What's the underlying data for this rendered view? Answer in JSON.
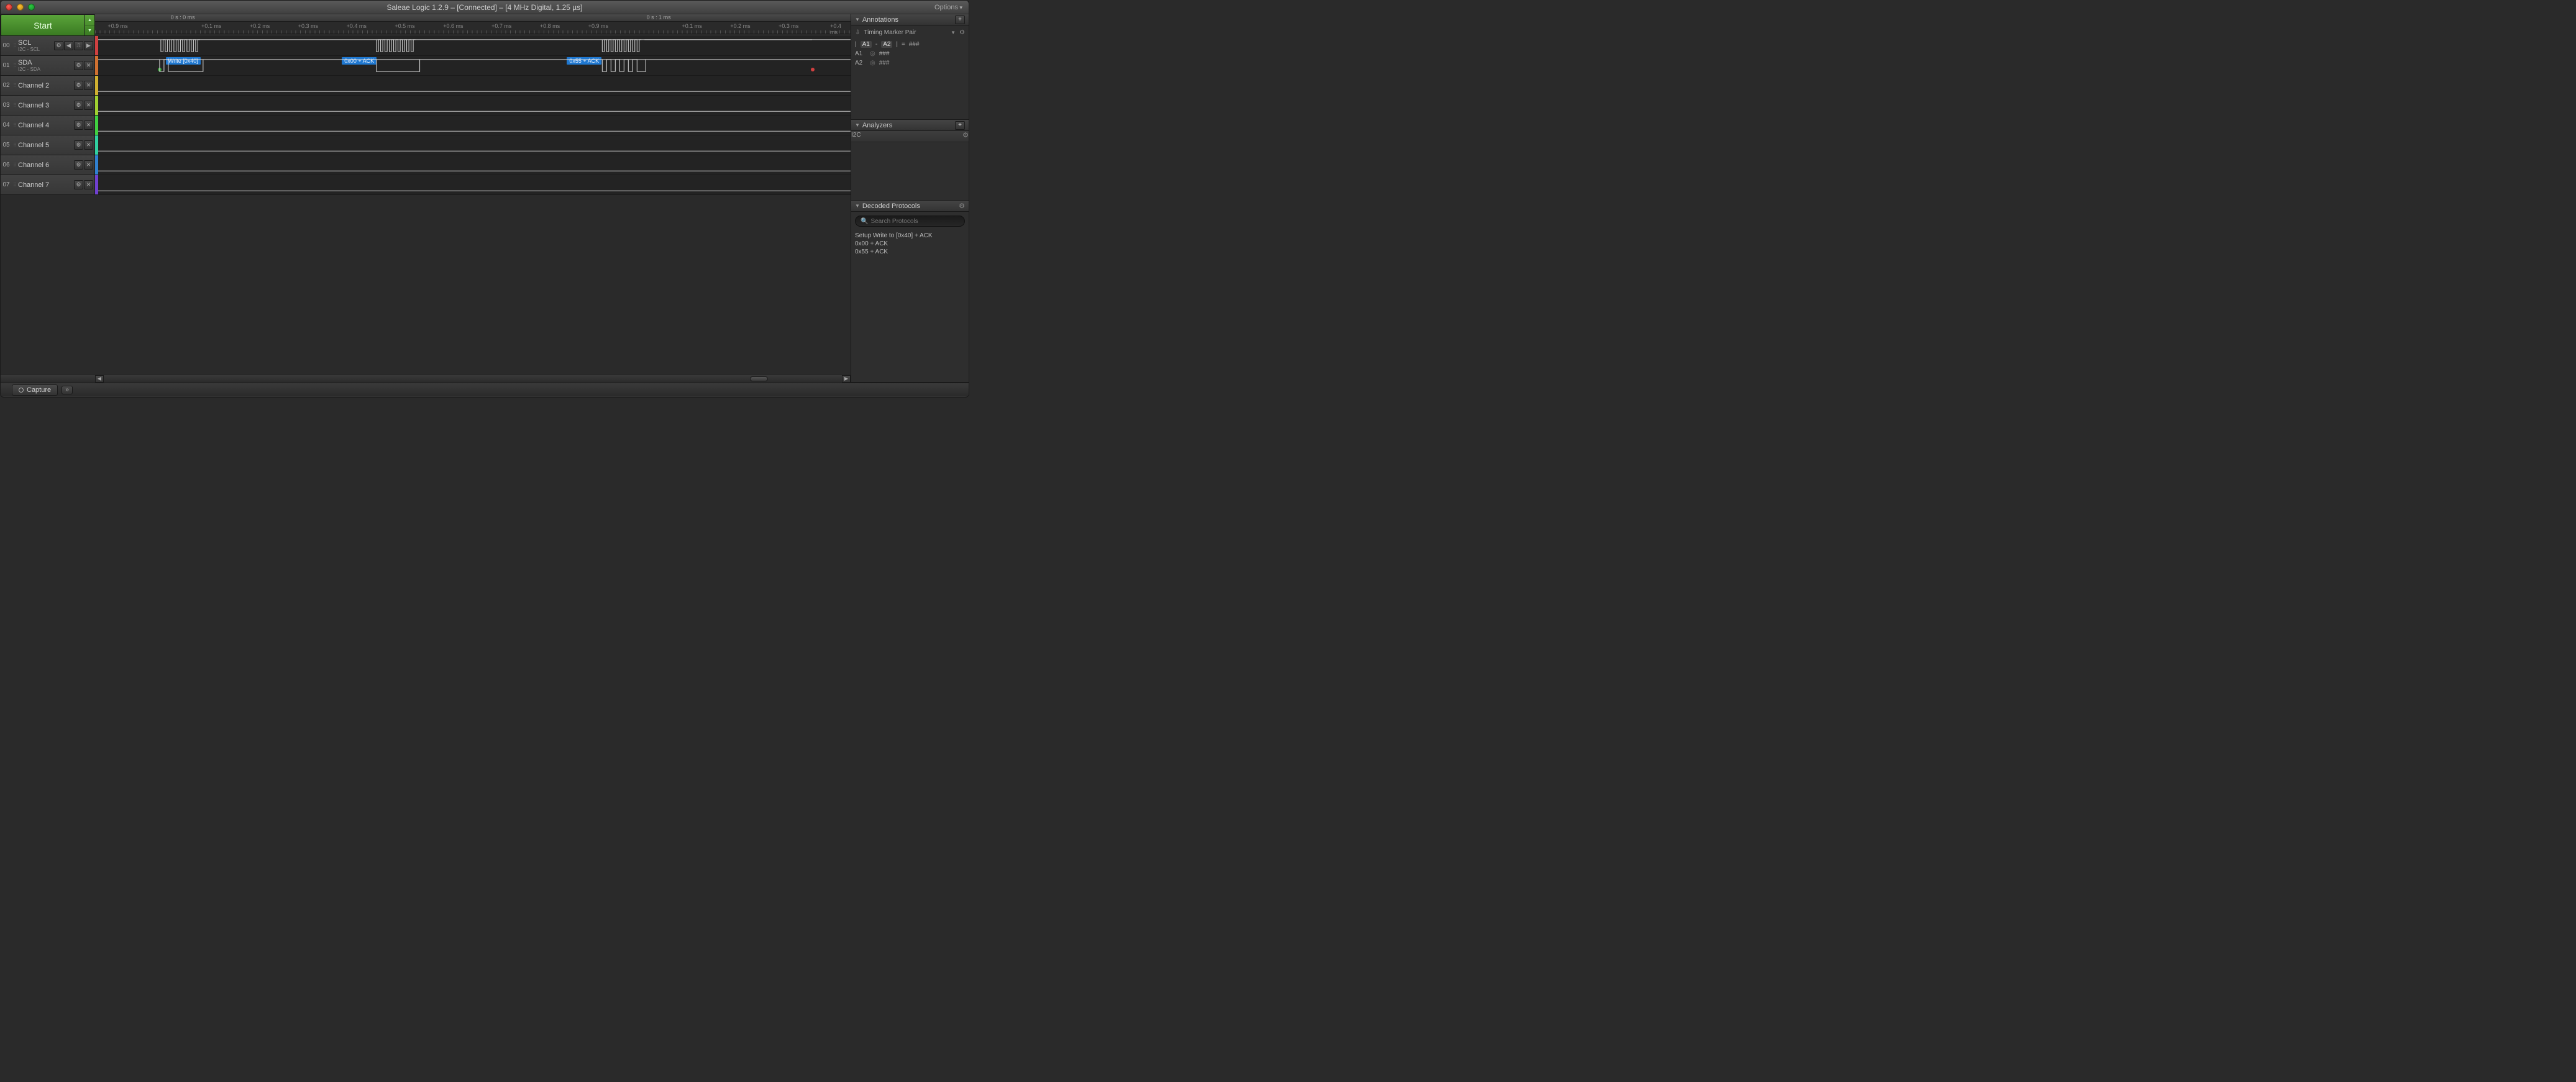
{
  "window": {
    "title": "Saleae Logic 1.2.9 – [Connected] – [4 MHz Digital, 1.25 µs]",
    "options_label": "Options"
  },
  "controls": {
    "start_label": "Start"
  },
  "timeline": {
    "anchors": [
      {
        "label": "0 s : 0 ms",
        "left_pct": 10
      },
      {
        "label": "0 s : 1 ms",
        "left_pct": 73
      }
    ],
    "minor_ticks": [
      {
        "label": "+0.9 ms",
        "left_pct": 3.0
      },
      {
        "label": "+0.1 ms",
        "left_pct": 15.4
      },
      {
        "label": "+0.2 ms",
        "left_pct": 21.8
      },
      {
        "label": "+0.3 ms",
        "left_pct": 28.2
      },
      {
        "label": "+0.4 ms",
        "left_pct": 34.6
      },
      {
        "label": "+0.5 ms",
        "left_pct": 41.0
      },
      {
        "label": "+0.6 ms",
        "left_pct": 47.4
      },
      {
        "label": "+0.7 ms",
        "left_pct": 53.8
      },
      {
        "label": "+0.8 ms",
        "left_pct": 60.2
      },
      {
        "label": "+0.9 ms",
        "left_pct": 66.6
      },
      {
        "label": "+0.1 ms",
        "left_pct": 79.0
      },
      {
        "label": "+0.2 ms",
        "left_pct": 85.4
      },
      {
        "label": "+0.3 ms",
        "left_pct": 91.8
      },
      {
        "label": "+0.4 ms",
        "left_pct": 98.2
      }
    ]
  },
  "channels": [
    {
      "idx": "00",
      "name": "SCL",
      "sub": "I2C - SCL",
      "color": "#d04040",
      "extra_buttons": true
    },
    {
      "idx": "01",
      "name": "SDA",
      "sub": "I2C - SDA",
      "color": "#d07030",
      "extra_buttons": false
    },
    {
      "idx": "02",
      "name": "Channel 2",
      "sub": "",
      "color": "#d0b030",
      "extra_buttons": false
    },
    {
      "idx": "03",
      "name": "Channel 3",
      "sub": "",
      "color": "#a0d030",
      "extra_buttons": false
    },
    {
      "idx": "04",
      "name": "Channel 4",
      "sub": "",
      "color": "#40d040",
      "extra_buttons": false
    },
    {
      "idx": "05",
      "name": "Channel 5",
      "sub": "",
      "color": "#30d0a0",
      "extra_buttons": false
    },
    {
      "idx": "06",
      "name": "Channel 6",
      "sub": "",
      "color": "#3080d0",
      "extra_buttons": false
    },
    {
      "idx": "07",
      "name": "Channel 7",
      "sub": "",
      "color": "#7040d0",
      "extra_buttons": false
    }
  ],
  "decoded_labels": [
    {
      "text": "Write [0x40]",
      "left_pct": 11.3
    },
    {
      "text": "0x00 + ACK",
      "left_pct": 34.7
    },
    {
      "text": "0x55 + ACK",
      "left_pct": 64.6
    }
  ],
  "markers": {
    "start": {
      "color": "#3aa13a",
      "left_pct": 8.18,
      "top_off": 22
    },
    "stop": {
      "color": "#d04040",
      "left_pct": 94.95,
      "top_off": 22
    }
  },
  "scroll": {
    "thumb_left_pct": 87.5,
    "thumb_width_pct": 2.5
  },
  "tabs": {
    "capture": "Capture"
  },
  "panels": {
    "annotations": {
      "title": "Annotations",
      "marker_pair_title": "Timing Marker Pair",
      "formula_left": "A1",
      "formula_right": "A2",
      "formula_eq": "###",
      "rows": [
        {
          "name": "A1",
          "value": "###"
        },
        {
          "name": "A2",
          "value": "###"
        }
      ]
    },
    "analyzers": {
      "title": "Analyzers",
      "items": [
        {
          "name": "I2C"
        }
      ]
    },
    "decoded": {
      "title": "Decoded Protocols",
      "search_placeholder": "Search Protocols",
      "lines": [
        "Setup Write to [0x40] + ACK",
        "0x00 + ACK",
        "0x55 + ACK"
      ]
    }
  }
}
